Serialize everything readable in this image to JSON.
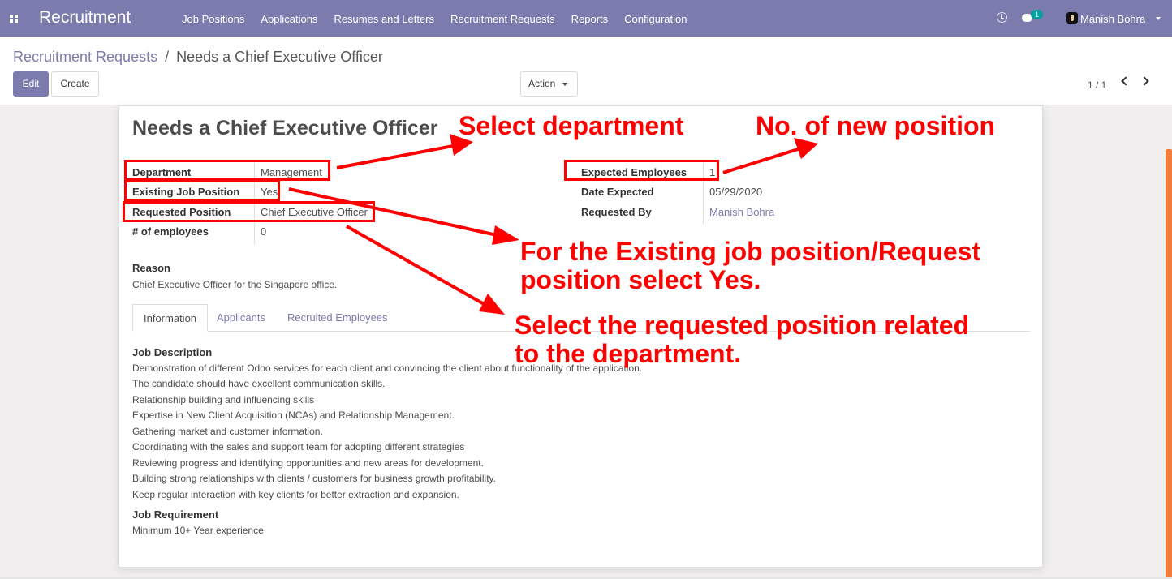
{
  "navbar": {
    "brand": "Recruitment",
    "menu": [
      "Job Positions",
      "Applications",
      "Resumes and Letters",
      "Recruitment Requests",
      "Reports",
      "Configuration"
    ],
    "chat_count": "1",
    "user_name": "Manish Bohra"
  },
  "breadcrumb": {
    "parent": "Recruitment Requests",
    "separator": "/",
    "current": "Needs a Chief Executive Officer"
  },
  "buttons": {
    "edit": "Edit",
    "create": "Create",
    "action": "Action"
  },
  "pager": "1 / 1",
  "form": {
    "title": "Needs a Chief Executive Officer",
    "left_fields": [
      {
        "label": "Department",
        "value": "Management"
      },
      {
        "label": "Existing Job Position",
        "value": "Yes"
      },
      {
        "label": "Requested Position",
        "value": "Chief Executive Officer"
      },
      {
        "label": "# of employees",
        "value": "0"
      }
    ],
    "right_fields": [
      {
        "label": "Expected Employees",
        "value": "1"
      },
      {
        "label": "Date Expected",
        "value": "05/29/2020"
      },
      {
        "label": "Requested By",
        "value": "Manish Bohra"
      }
    ],
    "reason_label": "Reason",
    "reason": "Chief Executive Officer for the Singapore office.",
    "tabs": [
      "Information",
      "Applicants",
      "Recruited Employees"
    ],
    "job_description_label": "Job Description",
    "job_description": [
      "Demonstration of different Odoo services for each client and convincing the client about functionality of the application.",
      "The candidate should have excellent communication skills.",
      "Relationship building and influencing skills",
      "Expertise in New Client Acquisition (NCAs) and Relationship Management.",
      "Gathering market and customer information.",
      "Coordinating with the sales and support team for adopting different strategies",
      "Reviewing progress and identifying opportunities and new areas for development.",
      "Building strong relationships with clients / customers for business growth profitability.",
      "Keep regular interaction with key clients for better extraction and expansion."
    ],
    "job_requirement_label": "Job Requirement",
    "job_requirement": "Minimum 10+ Year experience"
  },
  "annotations": {
    "select_department": "Select department",
    "new_position": "No. of new position",
    "existing_line1": "For the Existing job position/Request",
    "existing_line2": "position select Yes.",
    "requested_line1": "Select the requested position related",
    "requested_line2": "to the department.",
    "color": "#ff0000"
  },
  "colors": {
    "navbar": "#7c7bad",
    "link": "#7c7bad",
    "annotation": "#ff0000"
  }
}
